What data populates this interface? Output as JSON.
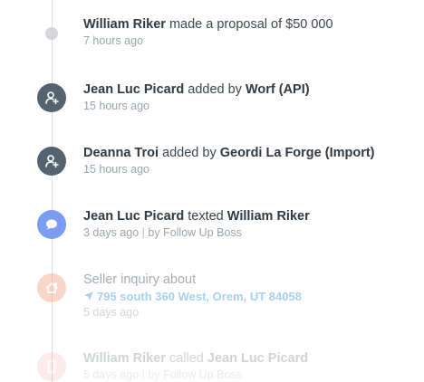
{
  "events": [
    {
      "actor": "William Riker",
      "action": "made a proposal of $50 000",
      "time": "7 hours ago"
    },
    {
      "actor": "Jean Luc Picard",
      "action": "added by",
      "target": "Worf (API)",
      "time": "15 hours ago"
    },
    {
      "actor": "Deanna Troi",
      "action": "added by",
      "target": "Geordi La Forge (Import)",
      "time": "15 hours ago"
    },
    {
      "actor": "Jean Luc Picard",
      "action": "texted",
      "target": "William Riker",
      "time": "3 days ago",
      "separator": "|",
      "source": "by Follow Up Boss"
    },
    {
      "title": "Seller inquiry",
      "action": "about",
      "address": "795 south 360 West, Orem, UT 84058",
      "time": "5 days ago"
    },
    {
      "actor": "William Riker",
      "action": "called",
      "target": "Jean Luc Picard",
      "time": "5 days ago",
      "separator": "|",
      "source": "by Follow Up Boss"
    }
  ],
  "icons": {
    "proposal": "dot-icon",
    "added": "add-person-icon",
    "text": "chat-bubble-icon",
    "inquiry": "house-icon",
    "call": "phone-icon",
    "location": "location-arrow-icon"
  },
  "colors": {
    "rail": "#d9dce0",
    "user_icon_bg": "#54636f",
    "text_icon_bg": "#7c9bf2",
    "inquiry_icon_bg": "#f6a58a",
    "call_icon_bg": "#f3a6a3",
    "link": "#3b99d8"
  }
}
